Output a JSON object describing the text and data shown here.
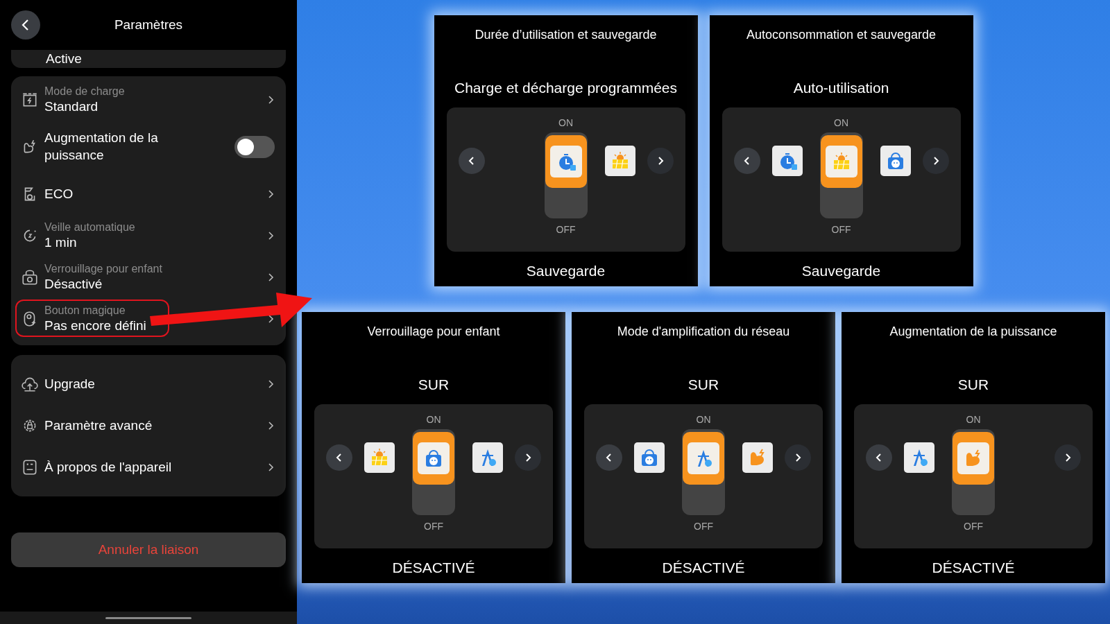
{
  "header": {
    "title": "Paramètres"
  },
  "top_card": {
    "value": "Active"
  },
  "groups": [
    {
      "items": [
        {
          "kind": "nav",
          "label": "Mode de charge",
          "value": "Standard",
          "highlighted": false
        },
        {
          "kind": "toggle",
          "label": "Augmentation de la puissance",
          "on": false,
          "highlighted": false
        },
        {
          "kind": "nav",
          "label": "ECO",
          "highlighted": false
        },
        {
          "kind": "nav",
          "label": "Veille automatique",
          "value": "1 min",
          "highlighted": false
        },
        {
          "kind": "nav",
          "label": "Verrouillage pour enfant",
          "value": "Désactivé",
          "highlighted": false
        },
        {
          "kind": "nav",
          "label": "Bouton magique",
          "value": "Pas encore défini",
          "highlighted": true
        }
      ]
    },
    {
      "items": [
        {
          "kind": "nav",
          "label": "Upgrade",
          "highlighted": false
        },
        {
          "kind": "nav",
          "label": "Paramètre avancé",
          "highlighted": false
        },
        {
          "kind": "nav",
          "label": "À propos de l'appareil",
          "highlighted": false
        }
      ]
    }
  ],
  "unlink_button": "Annuler la liaison",
  "cards": [
    {
      "title": "Durée d’utilisation et sauvegarde",
      "mode": "Charge et décharge programmées",
      "on_label": "ON",
      "off_label": "OFF",
      "status": "Sauvegarde",
      "icons": [
        {
          "kind": "timer",
          "selected": true
        },
        {
          "kind": "solar",
          "selected": false
        }
      ]
    },
    {
      "title": "Autoconsommation et sauvegarde",
      "mode": "Auto-utilisation",
      "on_label": "ON",
      "off_label": "OFF",
      "status": "Sauvegarde",
      "icons": [
        {
          "kind": "timer",
          "selected": false
        },
        {
          "kind": "solar",
          "selected": true
        },
        {
          "kind": "child",
          "selected": false
        }
      ]
    },
    {
      "title": "Verrouillage pour enfant",
      "mode": "SUR",
      "on_label": "ON",
      "off_label": "OFF",
      "status": "DÉSACTIVÉ",
      "icons": [
        {
          "kind": "solar",
          "selected": false
        },
        {
          "kind": "child",
          "selected": true
        },
        {
          "kind": "grid",
          "selected": false
        }
      ]
    },
    {
      "title": "Mode d'amplification du réseau",
      "mode": "SUR",
      "on_label": "ON",
      "off_label": "OFF",
      "status": "DÉSACTIVÉ",
      "icons": [
        {
          "kind": "child",
          "selected": false
        },
        {
          "kind": "grid",
          "selected": true
        },
        {
          "kind": "muscle",
          "selected": false
        }
      ]
    },
    {
      "title": "Augmentation de la puissance",
      "mode": "SUR",
      "on_label": "ON",
      "off_label": "OFF",
      "status": "DÉSACTIVÉ",
      "icons": [
        {
          "kind": "grid",
          "selected": false
        },
        {
          "kind": "muscle",
          "selected": true
        }
      ]
    }
  ]
}
